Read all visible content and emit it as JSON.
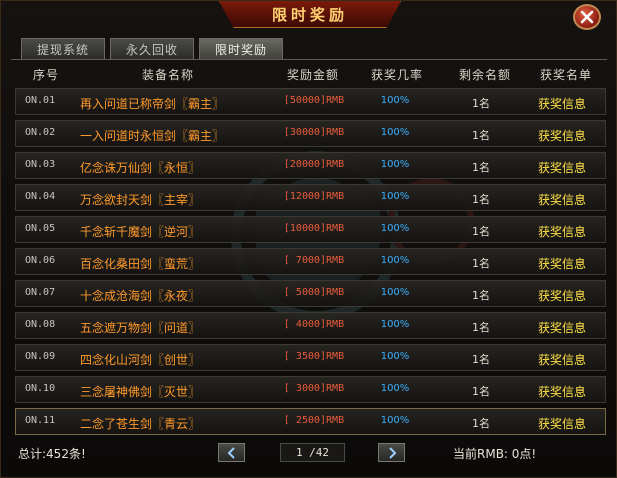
{
  "window": {
    "title": "限时奖励"
  },
  "tabs": [
    {
      "label": "提现系统"
    },
    {
      "label": "永久回收"
    },
    {
      "label": "限时奖励"
    }
  ],
  "table": {
    "headers": [
      "序号",
      "装备名称",
      "奖励金额",
      "获奖几率",
      "剩余名额",
      "获奖名单"
    ],
    "rows": [
      {
        "no": "ON.01",
        "name": "再入问道已称帝剑〖霸主〗",
        "amount": "[50000]RMB",
        "rate": "100%",
        "remaining": "1名",
        "info": "获奖信息"
      },
      {
        "no": "ON.02",
        "name": "一入问道时永恒剑〖霸主〗",
        "amount": "[30000]RMB",
        "rate": "100%",
        "remaining": "1名",
        "info": "获奖信息"
      },
      {
        "no": "ON.03",
        "name": "亿念诛万仙剑〖永恒〗",
        "amount": "[20000]RMB",
        "rate": "100%",
        "remaining": "1名",
        "info": "获奖信息"
      },
      {
        "no": "ON.04",
        "name": "万念欲封天剑〖主宰〗",
        "amount": "[12000]RMB",
        "rate": "100%",
        "remaining": "1名",
        "info": "获奖信息"
      },
      {
        "no": "ON.05",
        "name": "千念斩千魔剑〖逆河〗",
        "amount": "[10000]RMB",
        "rate": "100%",
        "remaining": "1名",
        "info": "获奖信息"
      },
      {
        "no": "ON.06",
        "name": "百念化桑田剑〖蛮荒〗",
        "amount": "[ 7000]RMB",
        "rate": "100%",
        "remaining": "1名",
        "info": "获奖信息"
      },
      {
        "no": "ON.07",
        "name": "十念成沧海剑〖永夜〗",
        "amount": "[ 5000]RMB",
        "rate": "100%",
        "remaining": "1名",
        "info": "获奖信息"
      },
      {
        "no": "ON.08",
        "name": "五念遮万物剑〖问道〗",
        "amount": "[ 4000]RMB",
        "rate": "100%",
        "remaining": "1名",
        "info": "获奖信息"
      },
      {
        "no": "ON.09",
        "name": "四念化山河剑〖创世〗",
        "amount": "[ 3500]RMB",
        "rate": "100%",
        "remaining": "1名",
        "info": "获奖信息"
      },
      {
        "no": "ON.10",
        "name": "三念屠神佛剑〖灭世〗",
        "amount": "[ 3000]RMB",
        "rate": "100%",
        "remaining": "1名",
        "info": "获奖信息"
      },
      {
        "no": "ON.11",
        "name": "二念了苍生剑〖青云〗",
        "amount": "[ 2500]RMB",
        "rate": "100%",
        "remaining": "1名",
        "info": "获奖信息"
      }
    ]
  },
  "footer": {
    "total": "总计:452条!",
    "page": "1 /42",
    "current_rmb": "当前RMB: 0点!"
  },
  "icons": {
    "close": "close-icon",
    "prev": "chevron-left-icon",
    "next": "chevron-right-icon"
  },
  "colors": {
    "item_name": "#ff9a2a",
    "amount": "#e85a3a",
    "rate": "#3ab0ff",
    "info": "#ffe14a"
  }
}
